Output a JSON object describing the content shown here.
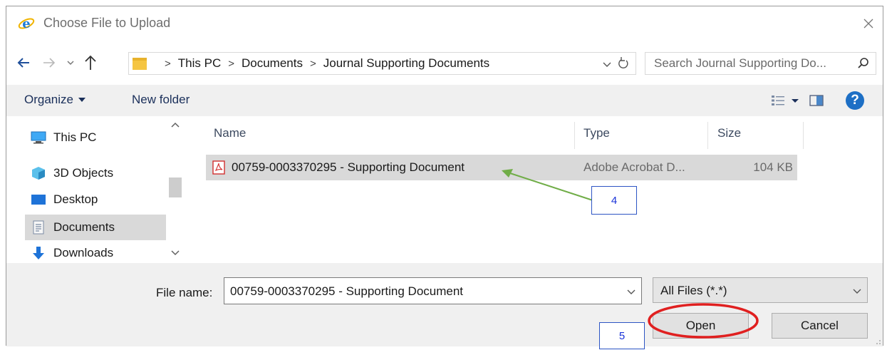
{
  "window": {
    "title": "Choose File to Upload"
  },
  "address": {
    "crumbs": [
      "This PC",
      "Documents",
      "Journal Supporting Documents"
    ],
    "separator": ">"
  },
  "search": {
    "placeholder": "Search Journal Supporting Do..."
  },
  "toolbar": {
    "organize_label": "Organize",
    "new_folder_label": "New folder",
    "help_label": "?"
  },
  "nav": {
    "items": [
      {
        "label": "This PC",
        "icon": "pc-icon"
      },
      {
        "label": "3D Objects",
        "icon": "3d-objects-icon"
      },
      {
        "label": "Desktop",
        "icon": "desktop-icon"
      },
      {
        "label": "Documents",
        "icon": "documents-icon",
        "selected": true
      },
      {
        "label": "Downloads",
        "icon": "downloads-icon"
      }
    ]
  },
  "files": {
    "columns": [
      "Name",
      "Type",
      "Size"
    ],
    "rows": [
      {
        "name": "00759-0003370295 - Supporting Document",
        "type": "Adobe Acrobat D...",
        "size": "104 KB",
        "icon": "pdf-icon",
        "selected": true
      }
    ]
  },
  "bottom": {
    "file_name_label": "File name:",
    "file_name_value": "00759-0003370295 - Supporting Document",
    "file_type_value": "All Files (*.*)",
    "open_label": "Open",
    "cancel_label": "Cancel"
  },
  "annotations": {
    "step4": "4",
    "step5": "5"
  },
  "colors": {
    "accent_blue": "#1d6fc5",
    "annotation_border": "#2d55c4",
    "arrow_green": "#70ad47",
    "highlight_red": "#e02020"
  }
}
